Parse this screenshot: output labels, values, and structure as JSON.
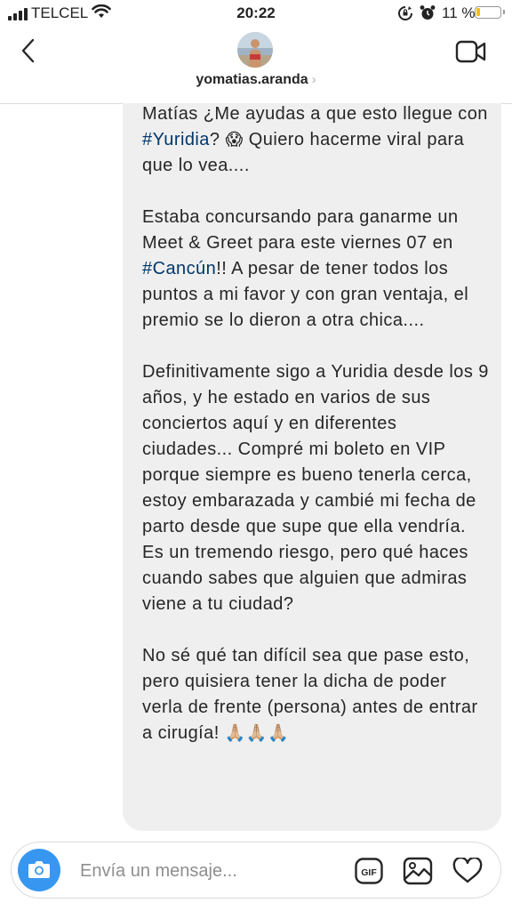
{
  "status_bar": {
    "carrier": "TELCEL",
    "time": "20:22",
    "battery_percent": "11 %",
    "battery_level": 0.11,
    "icons": [
      "signal-icon",
      "wifi-icon",
      "rotation-lock-icon",
      "alarm-icon",
      "battery-icon"
    ]
  },
  "header": {
    "username": "yomatias.aranda",
    "chevron": "›",
    "icons": [
      "back-chevron-icon",
      "avatar",
      "video-call-icon"
    ]
  },
  "message": {
    "p1": {
      "a": "Matías ¿Me ayudas a que esto llegue con ",
      "tag": "#Yuridia",
      "b": "? ",
      "emoji": "😱",
      "c": " Quiero hacerme viral para que lo vea...."
    },
    "p2": {
      "a": "Estaba concursando para ganarme un Meet & Greet para este viernes 07 en ",
      "tag": "#Cancún",
      "b": "!! A pesar de tener todos los puntos a mi favor y con gran ventaja, el premio se lo dieron a otra chica...."
    },
    "p3": "Definitivamente sigo a Yuridia desde los 9 años, y he estado en varios de sus conciertos aquí y en diferentes ciudades... Compré mi boleto en VIP porque siempre es bueno tenerla cerca, estoy embarazada y cambié mi fecha de parto desde que supe que ella vendría. Es un tremendo riesgo, pero qué haces cuando sabes que alguien que admiras viene a tu ciudad?",
    "p4": {
      "a": "No sé qué tan difícil sea que pase esto, pero quisiera tener la dicha de poder verla de frente (persona) antes de entrar a cirugía! ",
      "emoji": "🙏🏼🙏🏼🙏🏼"
    }
  },
  "composer": {
    "placeholder": "Envía un mensaje...",
    "gif_label": "GIF",
    "icons": [
      "camera-icon",
      "gif-icon",
      "photo-gallery-icon",
      "heart-icon"
    ]
  },
  "colors": {
    "hashtag": "#00376b",
    "bubble": "#efefef",
    "camera_button": "#3797f0",
    "battery_low": "#f4c20d"
  }
}
